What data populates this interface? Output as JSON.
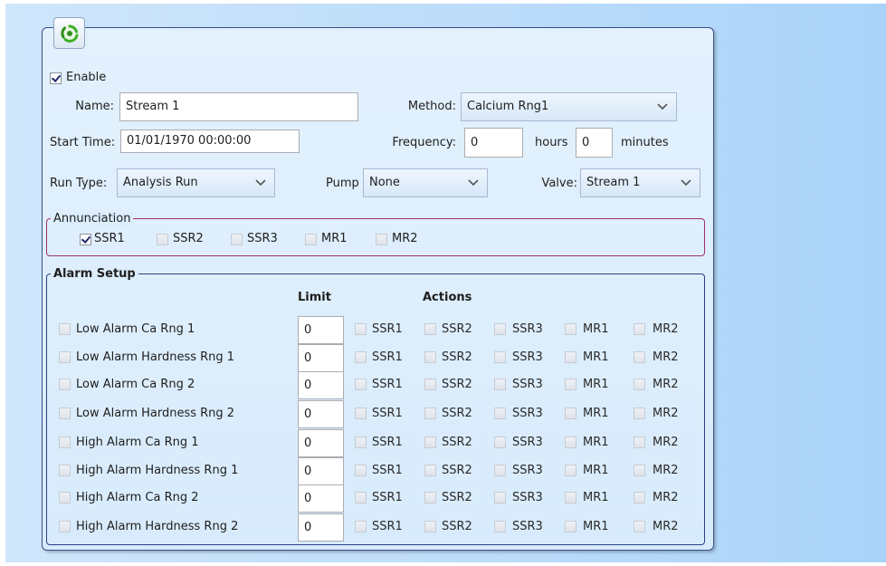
{
  "enable": {
    "label": "Enable",
    "checked": true
  },
  "name": {
    "label": "Name:",
    "value": "Stream 1"
  },
  "method": {
    "label": "Method:",
    "value": "Calcium Rng1"
  },
  "start_time": {
    "label": "Start Time:",
    "value": "01/01/1970 00:00:00"
  },
  "frequency": {
    "label": "Frequency:",
    "hours_value": "0",
    "hours_label": "hours",
    "minutes_value": "0",
    "minutes_label": "minutes"
  },
  "run_type": {
    "label": "Run Type:",
    "value": "Analysis Run"
  },
  "pump": {
    "label": "Pump",
    "value": "None"
  },
  "valve": {
    "label": "Valve:",
    "value": "Stream 1"
  },
  "annunciation": {
    "title": "Annunciation",
    "items": [
      {
        "label": "SSR1",
        "checked": true
      },
      {
        "label": "SSR2",
        "checked": false
      },
      {
        "label": "SSR3",
        "checked": false
      },
      {
        "label": "MR1",
        "checked": false
      },
      {
        "label": "MR2",
        "checked": false
      }
    ],
    "border_color": "#a0306a"
  },
  "alarm_setup": {
    "title": "Alarm Setup",
    "limit_header": "Limit",
    "actions_header": "Actions",
    "action_labels": [
      "SSR1",
      "SSR2",
      "SSR3",
      "MR1",
      "MR2"
    ],
    "rows": [
      {
        "label": "Low Alarm Ca Rng 1",
        "limit": "0"
      },
      {
        "label": "Low Alarm Hardness Rng 1",
        "limit": "0"
      },
      {
        "label": "Low Alarm Ca Rng 2",
        "limit": "0"
      },
      {
        "label": "Low Alarm Hardness Rng 2",
        "limit": "0"
      },
      {
        "label": "High Alarm Ca Rng 1",
        "limit": "0"
      },
      {
        "label": "High Alarm Hardness Rng 1",
        "limit": "0"
      },
      {
        "label": "High Alarm Ca Rng 2",
        "limit": "0"
      },
      {
        "label": "High Alarm Hardness Rng 2",
        "limit": "0"
      }
    ],
    "border_color": "#2b3f86"
  },
  "logo_icon": "recycle-arrows-icon",
  "accent_color": "#3b4f8a"
}
